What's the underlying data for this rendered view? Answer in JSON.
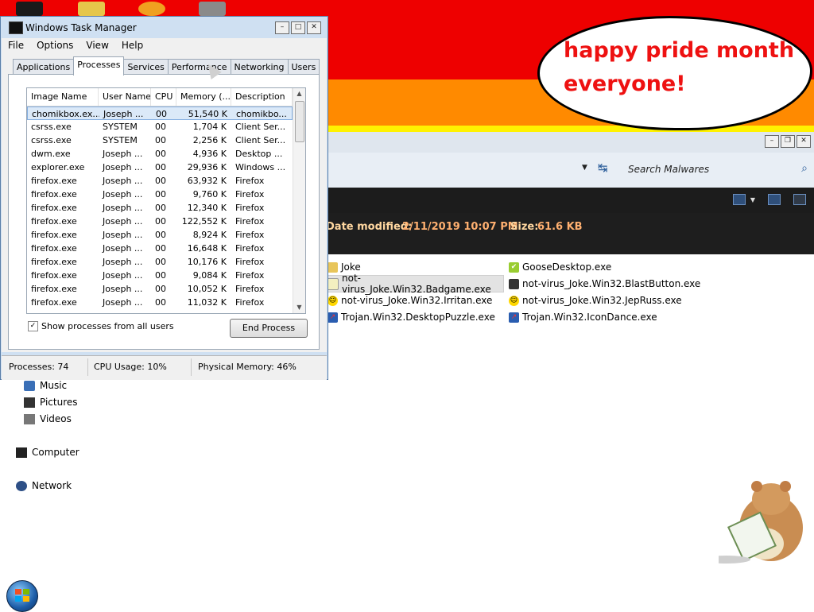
{
  "bubble": {
    "line1": "happy pride month",
    "line2": "everyone!"
  },
  "colors": {
    "red": "#ee0000",
    "orange": "#ff8a00",
    "yellow": "#fff200",
    "bubble_text": "#ee1111",
    "details_value": "#ffb070"
  },
  "explorer": {
    "search_placeholder": "Search Malwares",
    "details": {
      "date_label": "Date modified:",
      "date_value": "2/11/2019 10:07 PM",
      "size_label": "Size:",
      "size_value": "61.6 KB"
    },
    "files": [
      {
        "name": "Joke",
        "icon": "folder-icon"
      },
      {
        "name": "GooseDesktop.exe",
        "icon": "goose-icon"
      },
      {
        "name": "not-virus_Joke.Win32.Badgame.exe",
        "icon": "notepad-icon"
      },
      {
        "name": "not-virus_Joke.Win32.BlastButton.exe",
        "icon": "window-icon"
      },
      {
        "name": "not-virus_Joke.Win32.Irritan.exe",
        "icon": "smiley-icon"
      },
      {
        "name": "not-virus_Joke.Win32.JepRuss.exe",
        "icon": "smiley-icon"
      },
      {
        "name": "Trojan.Win32.DesktopPuzzle.exe",
        "icon": "trojan-icon"
      },
      {
        "name": "Trojan.Win32.IconDance.exe",
        "icon": "trojan-icon"
      }
    ]
  },
  "nav": {
    "music": "Music",
    "pictures": "Pictures",
    "videos": "Videos",
    "computer": "Computer",
    "network": "Network"
  },
  "taskmanager": {
    "title": "Windows Task Manager",
    "menu": [
      "File",
      "Options",
      "View",
      "Help"
    ],
    "tabs": [
      "Applications",
      "Processes",
      "Services",
      "Performance",
      "Networking",
      "Users"
    ],
    "active_tab": "Processes",
    "columns": [
      "Image Name",
      "User Name",
      "CPU",
      "Memory (...",
      "Description"
    ],
    "rows": [
      {
        "image": "chomikbox.ex...",
        "user": "Joseph ...",
        "cpu": "00",
        "mem": "51,540 K",
        "desc": "chomikbo..."
      },
      {
        "image": "csrss.exe",
        "user": "SYSTEM",
        "cpu": "00",
        "mem": "1,704 K",
        "desc": "Client Ser..."
      },
      {
        "image": "csrss.exe",
        "user": "SYSTEM",
        "cpu": "00",
        "mem": "2,256 K",
        "desc": "Client Ser..."
      },
      {
        "image": "dwm.exe",
        "user": "Joseph ...",
        "cpu": "00",
        "mem": "4,936 K",
        "desc": "Desktop ..."
      },
      {
        "image": "explorer.exe",
        "user": "Joseph ...",
        "cpu": "00",
        "mem": "29,936 K",
        "desc": "Windows ..."
      },
      {
        "image": "firefox.exe",
        "user": "Joseph ...",
        "cpu": "00",
        "mem": "63,932 K",
        "desc": "Firefox"
      },
      {
        "image": "firefox.exe",
        "user": "Joseph ...",
        "cpu": "00",
        "mem": "9,760 K",
        "desc": "Firefox"
      },
      {
        "image": "firefox.exe",
        "user": "Joseph ...",
        "cpu": "00",
        "mem": "12,340 K",
        "desc": "Firefox"
      },
      {
        "image": "firefox.exe",
        "user": "Joseph ...",
        "cpu": "00",
        "mem": "122,552 K",
        "desc": "Firefox"
      },
      {
        "image": "firefox.exe",
        "user": "Joseph ...",
        "cpu": "00",
        "mem": "8,924 K",
        "desc": "Firefox"
      },
      {
        "image": "firefox.exe",
        "user": "Joseph ...",
        "cpu": "00",
        "mem": "16,648 K",
        "desc": "Firefox"
      },
      {
        "image": "firefox.exe",
        "user": "Joseph ...",
        "cpu": "00",
        "mem": "10,176 K",
        "desc": "Firefox"
      },
      {
        "image": "firefox.exe",
        "user": "Joseph ...",
        "cpu": "00",
        "mem": "9,084 K",
        "desc": "Firefox"
      },
      {
        "image": "firefox.exe",
        "user": "Joseph ...",
        "cpu": "00",
        "mem": "10,052 K",
        "desc": "Firefox"
      },
      {
        "image": "firefox.exe",
        "user": "Joseph ...",
        "cpu": "00",
        "mem": "11,032 K",
        "desc": "Firefox"
      }
    ],
    "show_all_label": "Show processes from all users",
    "end_process_label": "End Process",
    "status": {
      "processes": "Processes: 74",
      "cpu": "CPU Usage: 10%",
      "memory": "Physical Memory: 46%"
    }
  }
}
